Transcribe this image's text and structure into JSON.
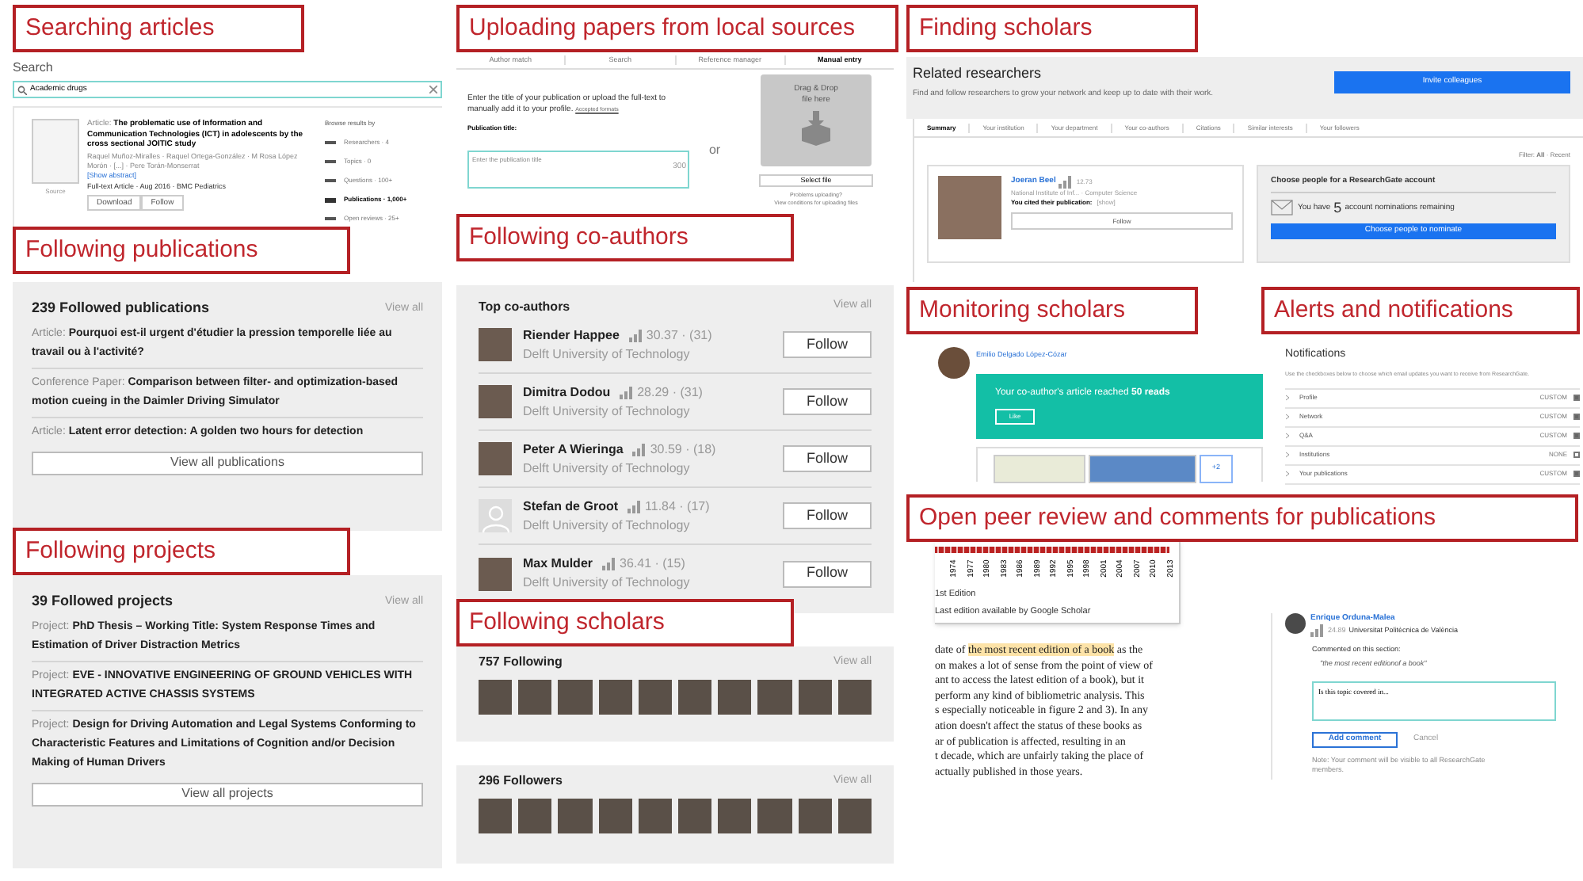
{
  "labels": [
    "Searching articles",
    "Following publications",
    "Following projects",
    "Uploading papers from local sources",
    "Following co-authors",
    "Following scholars",
    "Finding scholars",
    "Monitoring scholars",
    "Alerts and notifications",
    "Open peer review and comments for publications"
  ],
  "search": {
    "heading": "Search",
    "value": "Academic drugs",
    "result": {
      "type": "Article:",
      "title": "The problematic use of Information and Communication Technologies (ICT) in adolescents by the cross sectional JOITIC study",
      "authors": "Raquel Muñoz-Miralles · Raquel Ortega-González · M Rosa López Morón · [...] · Pere Torán-Monserrat",
      "abstract_link": "[Show abstract]",
      "meta": "Full-text Article · Aug 2016 · BMC Pediatrics",
      "source": "Source",
      "buttons": [
        "Download",
        "Follow"
      ]
    },
    "browse_title": "Browse results by",
    "browse": [
      {
        "label": "Researchers · 4",
        "selected": false
      },
      {
        "label": "Topics · 0",
        "selected": false
      },
      {
        "label": "Questions · 100+",
        "selected": false
      },
      {
        "label": "Publications · 1,000+",
        "selected": true
      },
      {
        "label": "Open reviews · 25+",
        "selected": false
      }
    ]
  },
  "publications": {
    "title": "239 Followed publications",
    "view_all": "View all",
    "items": [
      {
        "type": "Article:",
        "title": "Pourquoi est-il urgent d'étudier la pression temporelle liée au travail ou à l'activité?"
      },
      {
        "type": "Conference Paper:",
        "title": "Comparison between filter- and optimization-based motion cueing in the Daimler Driving Simulator"
      },
      {
        "type": "Article:",
        "title": "Latent error detection: A golden two hours for detection"
      }
    ],
    "button": "View all publications"
  },
  "projects": {
    "title": "39 Followed projects",
    "view_all": "View all",
    "items": [
      {
        "type": "Project:",
        "title": "PhD Thesis – Working Title: System Response Times and Estimation of Driver Distraction Metrics"
      },
      {
        "type": "Project:",
        "title": "EVE - INNOVATIVE ENGINEERING OF GROUND VEHICLES WITH INTEGRATED ACTIVE CHASSIS SYSTEMS"
      },
      {
        "type": "Project:",
        "title": "Design for Driving Automation and Legal Systems Conforming to Characteristic Features and Limitations of Cognition and/or Decision Making of Human Drivers"
      }
    ],
    "button": "View all projects"
  },
  "upload": {
    "tabs": [
      {
        "label": "Author match",
        "selected": false
      },
      {
        "label": "Search",
        "selected": false
      },
      {
        "label": "Reference manager",
        "selected": false
      },
      {
        "label": "Manual entry",
        "selected": true
      }
    ],
    "intro": "Enter the title of your publication or upload the full-text to manually add it to your profile.",
    "formats_link": "Accepted formats",
    "field_label": "Publication title:",
    "placeholder": "Enter the publication title",
    "counter": "300",
    "or": "or",
    "drop": "Drag & Drop file here",
    "select": "Select file",
    "problems": "Problems uploading?",
    "conditions": "View conditions for uploading files"
  },
  "coauthors": {
    "title": "Top co-authors",
    "view_all": "View all",
    "items": [
      {
        "name": "Riender Happee",
        "score": "30.37 · (31)",
        "affiliation": "Delft University of Technology",
        "kind": "photo",
        "button": "Follow"
      },
      {
        "name": "Dimitra Dodou",
        "score": "28.29 · (31)",
        "affiliation": "Delft University of Technology",
        "kind": "photo",
        "button": "Follow"
      },
      {
        "name": "Peter A Wieringa",
        "score": "30.59 · (18)",
        "affiliation": "Delft University of Technology",
        "kind": "photo",
        "button": "Follow"
      },
      {
        "name": "Stefan de Groot",
        "score": "11.84 · (17)",
        "affiliation": "Delft University of Technology",
        "kind": "silhouette",
        "button": "Follow"
      },
      {
        "name": "Max Mulder",
        "score": "36.41 · (15)",
        "affiliation": "Delft University of Technology",
        "kind": "photo",
        "button": "Follow"
      }
    ]
  },
  "following": {
    "count": "757",
    "label": "Following",
    "view_all": "View all"
  },
  "followers": {
    "count": "296",
    "label": "Followers",
    "view_all": "View all"
  },
  "related": {
    "title": "Related researchers",
    "description": "Find and follow researchers to grow your network and keep up to date with their work.",
    "invite": "Invite colleagues",
    "tabs": [
      {
        "label": "Summary",
        "selected": true
      },
      {
        "label": "Your institution",
        "selected": false
      },
      {
        "label": "Your department",
        "selected": false
      },
      {
        "label": "Your co-authors",
        "selected": false
      },
      {
        "label": "Citations",
        "selected": false
      },
      {
        "label": "Similar interests",
        "selected": false
      },
      {
        "label": "Your followers",
        "selected": false
      }
    ],
    "filter": "Filter: **All** · Recent",
    "researcher": {
      "name": "Joeran Beel",
      "score": "12.73",
      "affiliation": "National Institute of Inf... · Computer Science",
      "cited": "You cited their publication:",
      "show": "[show]",
      "button": "Follow"
    },
    "nominate": {
      "title": "Choose people for a ResearchGate account",
      "before": "You have",
      "count": "5",
      "after": "account nominations remaining",
      "button": "Choose people to nominate"
    }
  },
  "monitoring": {
    "name": "Emilio Delgado López-Cózar",
    "message": "Your co-author's article reached **50 reads**",
    "like": "Like",
    "more": "+2"
  },
  "notifications": {
    "title": "Notifications",
    "description": "Use the checkboxes below to choose which email updates you want to receive from ResearchGate.",
    "items": [
      {
        "label": "Profile",
        "setting": "CUSTOM",
        "checked": true
      },
      {
        "label": "Network",
        "setting": "CUSTOM",
        "checked": true
      },
      {
        "label": "Q&A",
        "setting": "CUSTOM",
        "checked": true
      },
      {
        "label": "Institutions",
        "setting": "NONE",
        "checked": false
      },
      {
        "label": "Your publications",
        "setting": "CUSTOM",
        "checked": true
      }
    ]
  },
  "review": {
    "years": [
      "1974",
      "1977",
      "1980",
      "1983",
      "1986",
      "1989",
      "1992",
      "1995",
      "1998",
      "2001",
      "2004",
      "2007",
      "2010",
      "2013"
    ],
    "legend": [
      "1st Edition",
      "Last edition available by Google Scholar"
    ],
    "first_line": [
      {
        "text": "date of ",
        "highlighted": false
      },
      {
        "text": "the most recent edition ",
        "highlighted": true
      },
      {
        "text": "of a book",
        "highlighted": true
      },
      {
        "text": " as the",
        "highlighted": false
      }
    ],
    "lines": [
      "on makes a lot of sense from the point of view of",
      "ant to access the latest edition of a book), but it",
      "perform any kind of bibliometric analysis. This",
      "s especially noticeable in figure 2 and 3). In any",
      "ation doesn't affect the status of these books as",
      "ar of publication is affected, resulting in an",
      "t decade, which are unfairly taking the place of",
      "actually published in those years."
    ],
    "comment": {
      "name": "Enrique Orduna-Malea",
      "score": "24.89",
      "affiliation": "Universitat Politècnica de València",
      "commented": "Commented on this section:",
      "quote": "\"the most recent editionof a book\"",
      "value": "Is this topic covered in...",
      "add": "Add comment",
      "cancel": "Cancel",
      "note": "Note: Your comment will be visible to all ResearchGate members."
    }
  }
}
